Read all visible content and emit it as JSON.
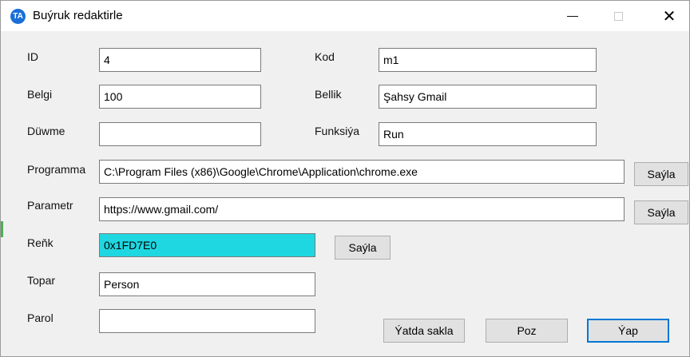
{
  "window": {
    "icon_text": "TA",
    "title": "Buýruk redaktirle",
    "min_symbol": "",
    "close_symbol": "✕"
  },
  "form": {
    "id": {
      "label": "ID",
      "value": "4"
    },
    "kod": {
      "label": "Kod",
      "value": "m1"
    },
    "belgi": {
      "label": "Belgi",
      "value": "100"
    },
    "bellik": {
      "label": "Bellik",
      "value": "Şahsy Gmail"
    },
    "duwme": {
      "label": "Düwme",
      "value": ""
    },
    "funksiya": {
      "label": "Funksiýa",
      "value": "Run"
    },
    "programma": {
      "label": "Programma",
      "value": "C:\\Program Files (x86)\\Google\\Chrome\\Application\\chrome.exe",
      "button": "Saýla"
    },
    "parametr": {
      "label": "Parametr",
      "value": "https://www.gmail.com/",
      "button": "Saýla"
    },
    "renk": {
      "label": "Reňk",
      "value": "0x1FD7E0",
      "button": "Saýla",
      "color": "#1FD7E0"
    },
    "topar": {
      "label": "Topar",
      "value": "Person"
    },
    "parol": {
      "label": "Parol",
      "value": ""
    }
  },
  "actions": {
    "save": "Ýatda sakla",
    "cancel": "Poz",
    "ok": "Ýap"
  }
}
